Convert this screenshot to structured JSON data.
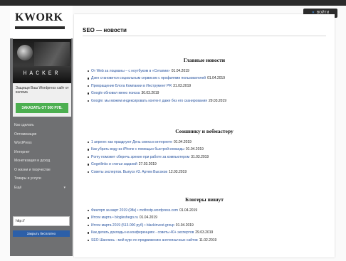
{
  "sidebar": {
    "logo": "KWORK",
    "ad": {
      "image_title": "HACKER",
      "text": "Защищи Ваш Wordpress сайт от взлома",
      "button": "ЗАКАЗАТЬ ОТ 500 РУБ."
    },
    "nav": [
      {
        "label": "Как сделать",
        "has_arrow": false
      },
      {
        "label": "Оптимизация",
        "has_arrow": false
      },
      {
        "label": "WordPress",
        "has_arrow": false
      },
      {
        "label": "Интернет",
        "has_arrow": false
      },
      {
        "label": "Монетизация и доход",
        "has_arrow": false
      },
      {
        "label": "О жизни и творчестве",
        "has_arrow": false
      },
      {
        "label": "Товары и услуги",
        "has_arrow": false
      },
      {
        "label": "Ещё",
        "has_arrow": true
      }
    ],
    "search": {
      "value": "http://",
      "button": "Закрыть бесплатно"
    }
  },
  "header": {
    "login_button": "ВОЙТИ",
    "login_icon": "close-icon"
  },
  "main": {
    "title": "SEO — новости",
    "sections": [
      {
        "title": "Главные новости",
        "items": [
          {
            "title": "От Web за лоцманы – с ноутбуком в «Сетапии»",
            "date": "01.04.2019"
          },
          {
            "title": "Дзен становится социальным сервисом с профилями пользователей",
            "date": "01.04.2019"
          },
          {
            "title": "Превращение Блога Компании в Инструмент PR",
            "date": "31.03.2019"
          },
          {
            "title": "Google обновил меню поиска",
            "date": "30.03.2019"
          },
          {
            "title": "Google: мы можем индексировать контент даже без его сканирования",
            "date": "29.03.2019"
          }
        ]
      },
      {
        "title": "Сеошнику и вебмастеру",
        "items": [
          {
            "title": "1 апреля: как празднуют День смеха в интернете",
            "date": "01.04.2019"
          },
          {
            "title": "Как убрать воду из iPhone с помощью быстрой команды",
            "date": "01.04.2019"
          },
          {
            "title": "Pomy поможет сберечь зрение при работе за компьютером",
            "date": "31.03.2019"
          },
          {
            "title": "Gogetlinks и статьи заданий",
            "date": "27.03.2019"
          },
          {
            "title": "Советы экспертов. Выпуск #3. Артем Высоков",
            "date": "12.03.2019"
          }
        ]
      },
      {
        "title": "Блогеры пишут",
        "items": [
          {
            "title": "Фингпрп за март 2019 (98к) • mofinstp.wordpress.com",
            "date": "01.04.2019"
          },
          {
            "title": "Итоги марта • blogleshego.ru",
            "date": "01.04.2019"
          },
          {
            "title": "Итоги марта 2019 (513.000 руб) • blackinvest.group",
            "date": "01.04.2019"
          },
          {
            "title": "Как делать доклады на конференциях - советы 40+ экспертов",
            "date": "29.03.2019"
          },
          {
            "title": "SEO Шаолинь - мой курс по продвижению англоязычных сайтов",
            "date": "11.02.2019"
          }
        ]
      }
    ]
  },
  "colors": {
    "link": "#2a55a0",
    "sidebar_bg": "#6f7072",
    "ad_button": "#4caf50",
    "search_button": "#2c5fa8"
  }
}
